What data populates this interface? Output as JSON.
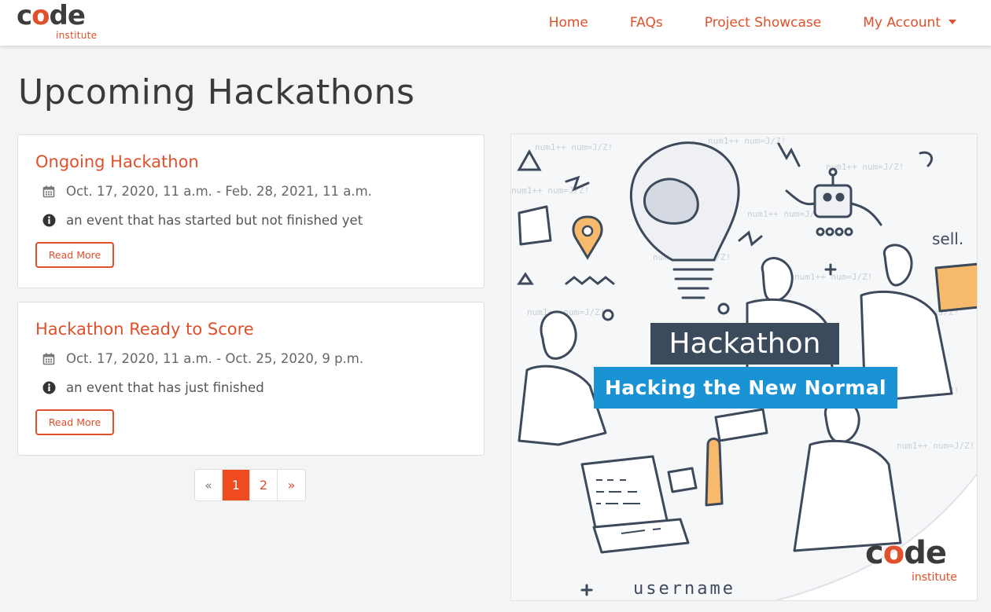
{
  "nav": {
    "brand_word_pre": "c",
    "brand_word_o": "o",
    "brand_word_post": "de",
    "brand_sub": "institute",
    "links": [
      "Home",
      "FAQs",
      "Project Showcase",
      "My Account"
    ]
  },
  "page_title": "Upcoming Hackathons",
  "cards": [
    {
      "title": "Ongoing Hackathon",
      "dates": "Oct. 17, 2020, 11 a.m. - Feb. 28, 2021, 11 a.m.",
      "description": "an event that has started but not finished yet",
      "button": "Read More"
    },
    {
      "title": "Hackathon Ready to Score",
      "dates": "Oct. 17, 2020, 11 a.m. - Oct. 25, 2020, 9 p.m.",
      "description": "an event that has just finished",
      "button": "Read More"
    }
  ],
  "pagination": {
    "prev": "«",
    "pages": [
      "1",
      "2"
    ],
    "current": "1",
    "next": "»"
  },
  "hero": {
    "title": "Hackathon",
    "subtitle": "Hacking the New Normal",
    "logo_pre": "c",
    "logo_o": "o",
    "logo_post": "de",
    "logo_sub": "institute",
    "scribble_text": "username",
    "sign_text": "sell.",
    "code_text": "num1++ num=J/Z!"
  },
  "colors": {
    "accent": "#e0502a",
    "active_page": "#f04a1f",
    "hero_title_bg": "#3c4b5c",
    "hero_sub_bg": "#1a93d4"
  }
}
